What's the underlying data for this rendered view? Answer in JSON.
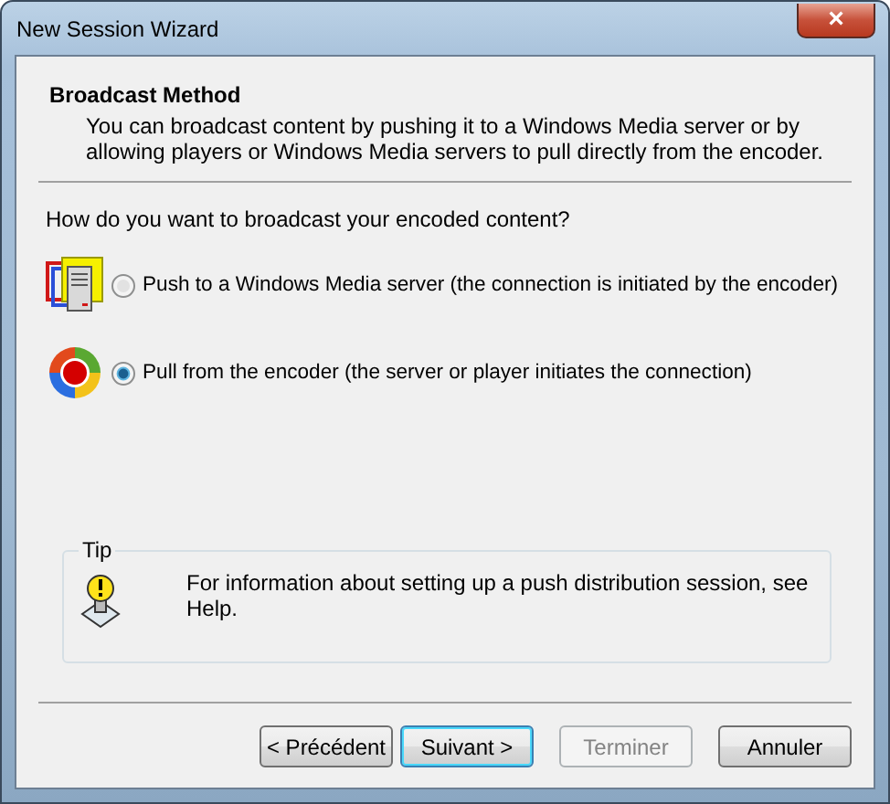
{
  "window": {
    "title": "New Session Wizard",
    "close": "×"
  },
  "header": {
    "title": "Broadcast Method",
    "description": "You can broadcast content by pushing it to a Windows Media server or by allowing players or Windows Media servers to pull directly from the encoder."
  },
  "question": "How do you want to broadcast your encoded content?",
  "options": [
    {
      "kind": "server",
      "label": "Push to a Windows Media server (the connection is initiated by the encoder)",
      "selected": false
    },
    {
      "kind": "player",
      "label": "Pull from the encoder (the server or player initiates the connection)",
      "selected": true
    }
  ],
  "tip": {
    "title": "Tip",
    "text": "For information about setting up a push distribution session, see Help."
  },
  "buttons": [
    {
      "label": "< Précédent",
      "default": false,
      "disabled": false
    },
    {
      "label": "Suivant >",
      "default": true,
      "disabled": false
    },
    {
      "label": "Terminer",
      "default": false,
      "disabled": true
    },
    {
      "label": "Annuler",
      "default": false,
      "disabled": false
    }
  ]
}
